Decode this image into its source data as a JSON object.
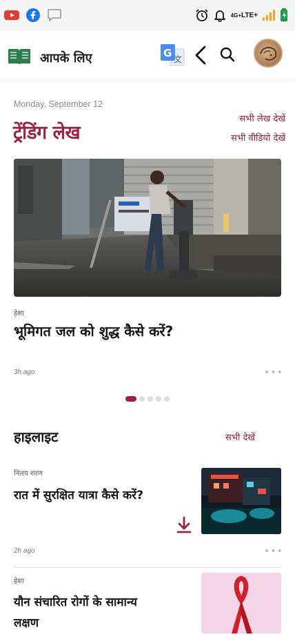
{
  "status_bar": {
    "icons_left": [
      "youtube-icon",
      "facebook-icon",
      "message-icon"
    ],
    "icons_right": [
      "alarm-icon",
      "bell-icon",
      "lte-signal-icon",
      "battery-icon"
    ],
    "network_top": "4G+",
    "network_bottom": "LTE+"
  },
  "app_bar": {
    "title": "आपके लिए",
    "icons": [
      "book-logo-icon",
      "translate-icon",
      "back-icon",
      "search-icon",
      "avatar"
    ]
  },
  "trending": {
    "date": "Monday, September 12",
    "title": "ट्रेंडिंग लेख",
    "see_all_articles": "सभी लेख देखें",
    "see_all_videos": "सभी वीडियो देखें",
    "hero": {
      "category": "हेशा",
      "headline": "भूमिगत जल को शुद्ध कैसे करें?",
      "time": "3h ago"
    },
    "carousel": {
      "count": 5,
      "active": 0
    }
  },
  "highlights": {
    "title": "हाइलाइट",
    "see_all": "सभी देखें",
    "items": [
      {
        "category": "निलय शरण",
        "headline": "रात में सुरक्षित यात्रा कैसे करें?",
        "time": "2h ago"
      },
      {
        "category": "हेशा",
        "headline": "यौन संचारित रोगों के सामान्य लक्षण"
      }
    ]
  },
  "colors": {
    "accent": "#9a2244",
    "status_bar_bg": "#f5f5f5",
    "logo_green": "#2e7d4f",
    "translate_blue": "#4a8ef0"
  }
}
